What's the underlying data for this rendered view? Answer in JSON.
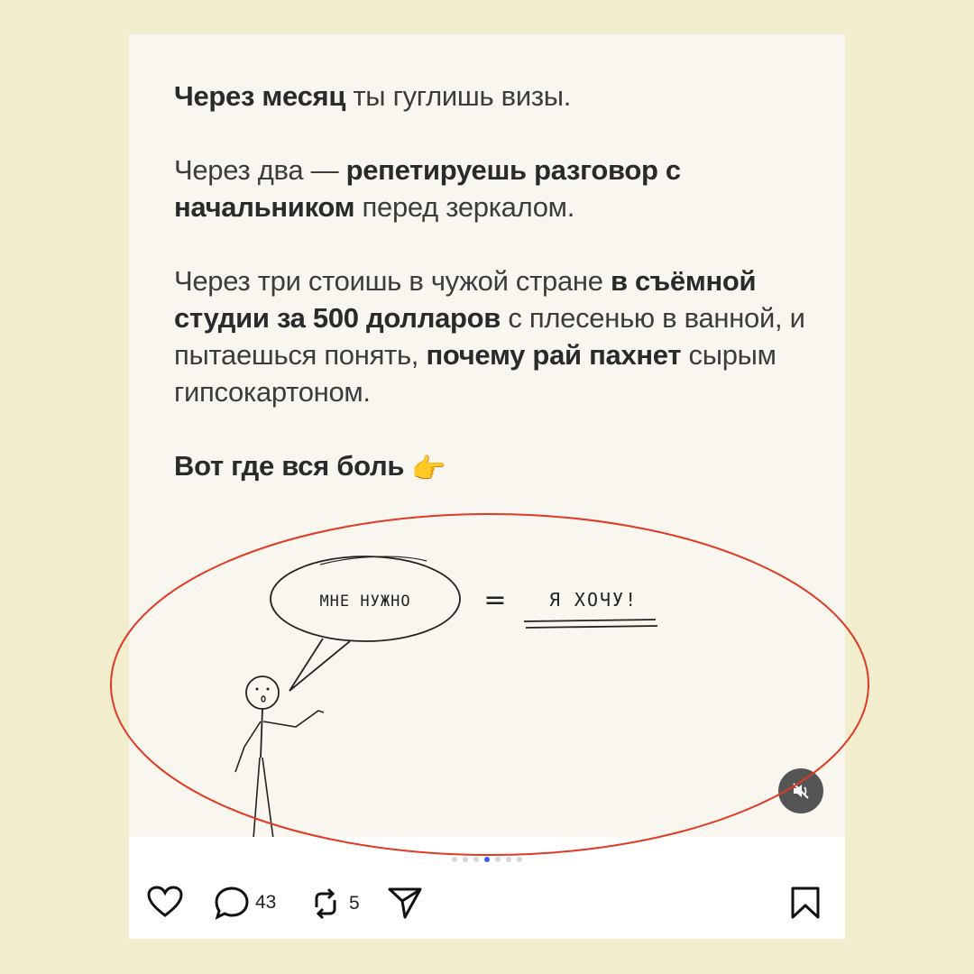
{
  "post": {
    "paragraphs": [
      {
        "segments": [
          {
            "text": "Через месяц",
            "bold": true
          },
          {
            "text": " ты гуглишь визы.",
            "bold": false
          }
        ]
      },
      {
        "segments": [
          {
            "text": "Через два — ",
            "bold": false
          },
          {
            "text": "репетируешь разговор с начальником",
            "bold": true
          },
          {
            "text": " перед зеркалом.",
            "bold": false
          }
        ]
      },
      {
        "segments": [
          {
            "text": "Через три стоишь в чужой стране ",
            "bold": false
          },
          {
            "text": "в съёмной студии за 500 долларов",
            "bold": true
          },
          {
            "text": " с плесенью в ванной, и пытаешься понять, ",
            "bold": false
          },
          {
            "text": "почему рай пахнет",
            "bold": true
          },
          {
            "text": " сырым гипсокартоном.",
            "bold": false
          }
        ]
      },
      {
        "segments": [
          {
            "text": "Вот где вся боль ",
            "bold": true
          }
        ],
        "emoji": "👉"
      }
    ],
    "sketch": {
      "speech_text": "МНЕ НУЖНО",
      "equals": "=",
      "answer_text": "Я ХОЧУ!"
    }
  },
  "carousel": {
    "count": 7,
    "active_index": 3
  },
  "actions": {
    "comments_count": "43",
    "reposts_count": "5"
  },
  "icons": [
    "heart-icon",
    "comment-icon",
    "repost-icon",
    "share-icon",
    "bookmark-icon",
    "muted-speaker-icon",
    "pointing-right-emoji"
  ],
  "colors": {
    "page_background": "#f2edcc",
    "highlight_ellipse": "#e03a24",
    "active_dot": "#3d5afe"
  }
}
